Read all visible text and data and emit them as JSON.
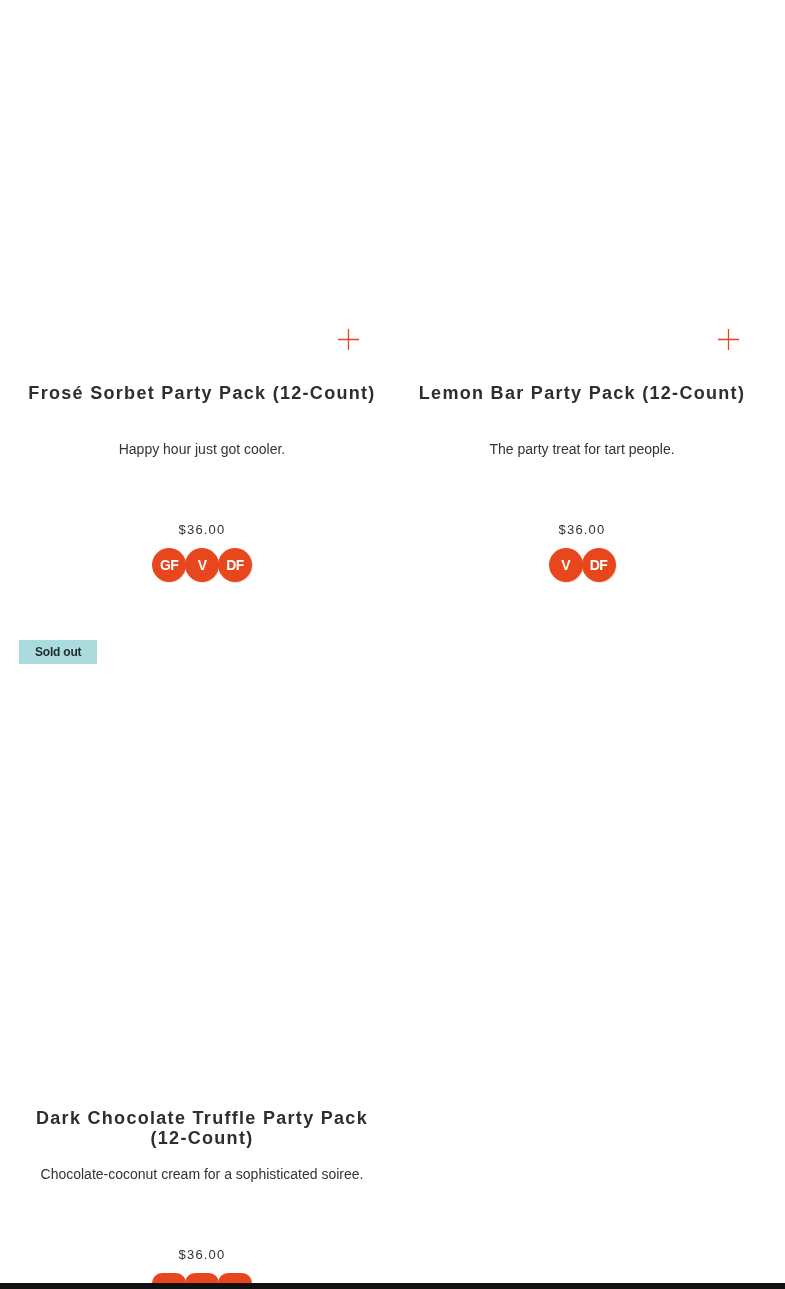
{
  "products": [
    {
      "title": "Frosé Sorbet Party Pack (12-Count)",
      "description": "Happy hour just got cooler.",
      "price": "$36.00",
      "quick_add": true,
      "badges": [
        {
          "kind": "text",
          "label": "GF"
        },
        {
          "kind": "text",
          "label": "V"
        },
        {
          "kind": "text",
          "label": "DF"
        }
      ]
    },
    {
      "title": "Lemon Bar Party Pack (12-Count)",
      "description": "The party treat for tart people.",
      "price": "$36.00",
      "quick_add": true,
      "badges": [
        {
          "kind": "text",
          "label": "V"
        },
        {
          "kind": "text",
          "label": "DF"
        }
      ]
    },
    {
      "tag": "Sold out",
      "title": "Dark Chocolate Truffle Party Pack (12-Count)",
      "description": "Chocolate-coconut cream for a sophisticated soiree.",
      "price": "$36.00",
      "quick_add": false,
      "badges": [
        {
          "kind": "clipped"
        },
        {
          "kind": "clipped"
        },
        {
          "kind": "clipped"
        }
      ]
    }
  ]
}
